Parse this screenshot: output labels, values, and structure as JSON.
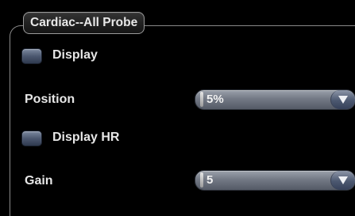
{
  "group": {
    "title": "Cardiac--All Probe"
  },
  "controls": {
    "display": {
      "label": "Display",
      "checked": false
    },
    "position": {
      "label": "Position",
      "value": "5%"
    },
    "display_hr": {
      "label": "Display HR",
      "checked": false
    },
    "gain": {
      "label": "Gain",
      "value": "5"
    }
  },
  "icons": {
    "dropdown": "chevron-down-icon"
  },
  "colors": {
    "background": "#000000",
    "text": "#e6e6e6",
    "checkbox": "#4c5870",
    "combo": "#737985"
  }
}
